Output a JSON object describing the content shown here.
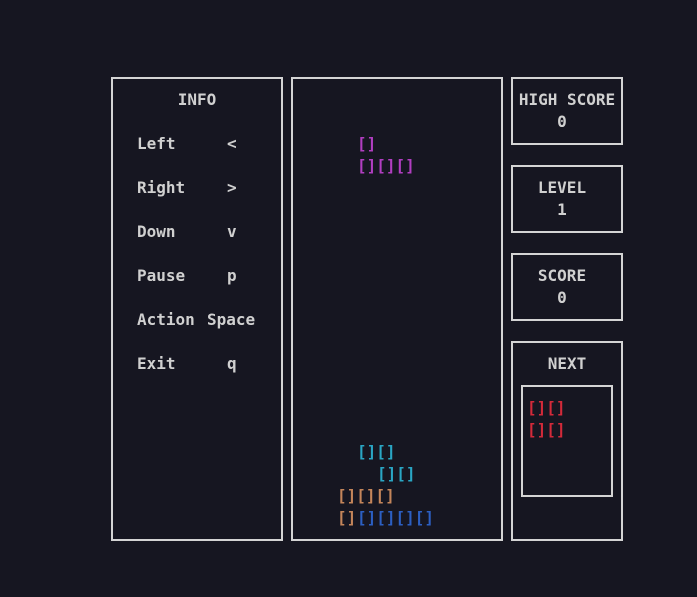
{
  "info": {
    "title": "INFO",
    "controls": [
      {
        "action": "Left",
        "key": "<"
      },
      {
        "action": "Right",
        "key": ">"
      },
      {
        "action": "Down",
        "key": "v"
      },
      {
        "action": "Pause",
        "key": "p"
      },
      {
        "action": "Action",
        "key": "Space"
      },
      {
        "action": "Exit",
        "key": "q"
      }
    ]
  },
  "high_score": {
    "label": "HIGH SCORE",
    "value": "0"
  },
  "level": {
    "label": "LEVEL",
    "value": "1"
  },
  "score": {
    "label": "SCORE",
    "value": "0"
  },
  "next": {
    "label": "NEXT",
    "piece_color": "#d32a3a",
    "rows": [
      "[][]",
      "[][]"
    ]
  },
  "board": {
    "falling_piece": {
      "color": "#b13ec1",
      "rows": [
        "[]",
        "[][][]"
      ]
    },
    "stack": [
      {
        "color": "#2aa6c4",
        "text": "[][]"
      },
      {
        "color": "#2aa6c4",
        "text": "[][]"
      },
      {
        "color": "#c4855a",
        "text": "[][][]"
      },
      {
        "color": "#c4855a",
        "text": "[]"
      },
      {
        "color": "#2c5fc2",
        "text": "[][][][]"
      }
    ]
  },
  "colors": {
    "background": "#161621",
    "border": "#d4d4d4",
    "text": "#d0d0d0"
  }
}
